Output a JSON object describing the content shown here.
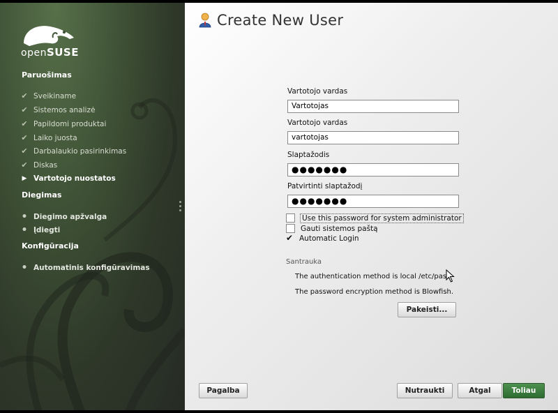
{
  "sidebar": {
    "logo_text_a": "open",
    "logo_text_b": "SUSE",
    "sections": [
      {
        "title": "Paruošimas"
      },
      {
        "title": "Diegimas"
      },
      {
        "title": "Konfigūracija"
      }
    ],
    "steps": [
      {
        "label": "Sveikiname",
        "state": "done"
      },
      {
        "label": "Sistemos analizė",
        "state": "done"
      },
      {
        "label": "Papildomi produktai",
        "state": "done"
      },
      {
        "label": "Laiko juosta",
        "state": "done"
      },
      {
        "label": "Darbalaukio pasirinkimas",
        "state": "done"
      },
      {
        "label": "Diskas",
        "state": "done"
      },
      {
        "label": "Vartotojo nuostatos",
        "state": "current"
      },
      {
        "label": "Diegimo apžvalga",
        "state": "future"
      },
      {
        "label": "Įdiegti",
        "state": "future"
      },
      {
        "label": "Automatinis konfigūravimas",
        "state": "future"
      }
    ]
  },
  "header": {
    "title": "Create New User"
  },
  "form": {
    "full_name_label": "Vartotojo vardas",
    "full_name_value": "Vartotojas",
    "username_label": "Vartotojo vardas",
    "username_value": "vartotojas",
    "password_label": "Slaptažodis",
    "password_value": "●●●●●●●",
    "confirm_label": "Patvirtinti slaptažodį",
    "confirm_value": "●●●●●●●",
    "checkboxes": [
      {
        "label": "Use this password for system administrator",
        "checked": false
      },
      {
        "label": "Gauti sistemos paštą",
        "checked": false
      },
      {
        "label": "Automatic Login",
        "checked": true
      }
    ]
  },
  "summary": {
    "heading": "Santrauka",
    "line1": "The authentication method is local /etc/passwd.",
    "line2": "The password encryption method is Blowfish.",
    "change_button": "Pakeisti..."
  },
  "footer": {
    "help": "Pagalba",
    "abort": "Nutraukti",
    "back": "Atgal",
    "next": "Toliau"
  },
  "colors": {
    "accent": "#3a7a3d",
    "sidebar": "#3f5236"
  }
}
